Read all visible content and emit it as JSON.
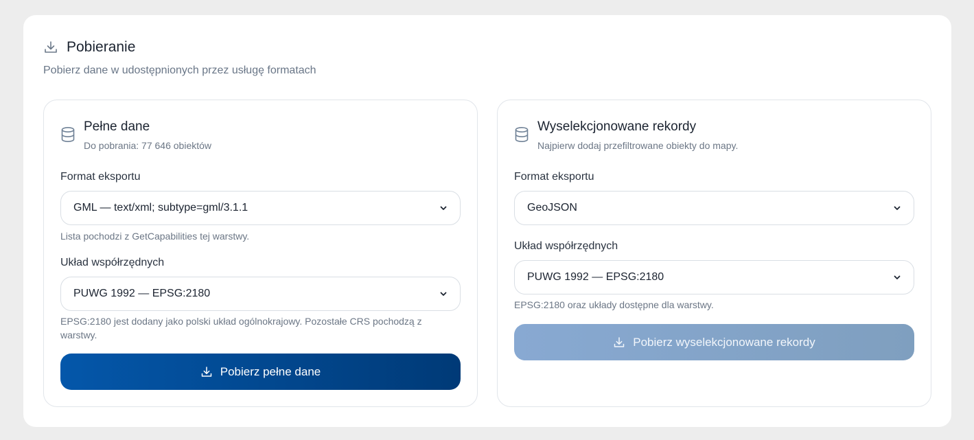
{
  "panel": {
    "title": "Pobieranie",
    "subtitle": "Pobierz dane w udostępnionych przez usługę formatach",
    "icon": "download-icon"
  },
  "full_data": {
    "title": "Pełne dane",
    "description": "Do pobrania: 77 646 obiektów",
    "icon": "database-icon",
    "format_label": "Format eksportu",
    "format_value": "GML — text/xml; subtype=gml/3.1.1",
    "format_hint": "Lista pochodzi z GetCapabilities tej warstwy.",
    "crs_label": "Układ współrzędnych",
    "crs_value": "PUWG 1992 — EPSG:2180",
    "crs_hint": "EPSG:2180 jest dodany jako polski układ ogólnokrajowy. Pozostałe CRS pochodzą z warstwy.",
    "button_label": "Pobierz pełne dane"
  },
  "selected_records": {
    "title": "Wyselekcjonowane rekordy",
    "description": "Najpierw dodaj przefiltrowane obiekty do mapy.",
    "icon": "database-icon",
    "format_label": "Format eksportu",
    "format_value": "GeoJSON",
    "crs_label": "Układ współrzędnych",
    "crs_value": "PUWG 1992 — EPSG:2180",
    "crs_hint": "EPSG:2180 oraz układy dostępne dla warstwy.",
    "button_label": "Pobierz wyselekcjonowane rekordy",
    "button_state": "disabled"
  },
  "colors": {
    "primary_start": "#0457aa",
    "primary_end": "#003a77",
    "disabled_button": "#88a9d2",
    "muted_text": "#6b7685",
    "border": "#e1e5ea"
  }
}
